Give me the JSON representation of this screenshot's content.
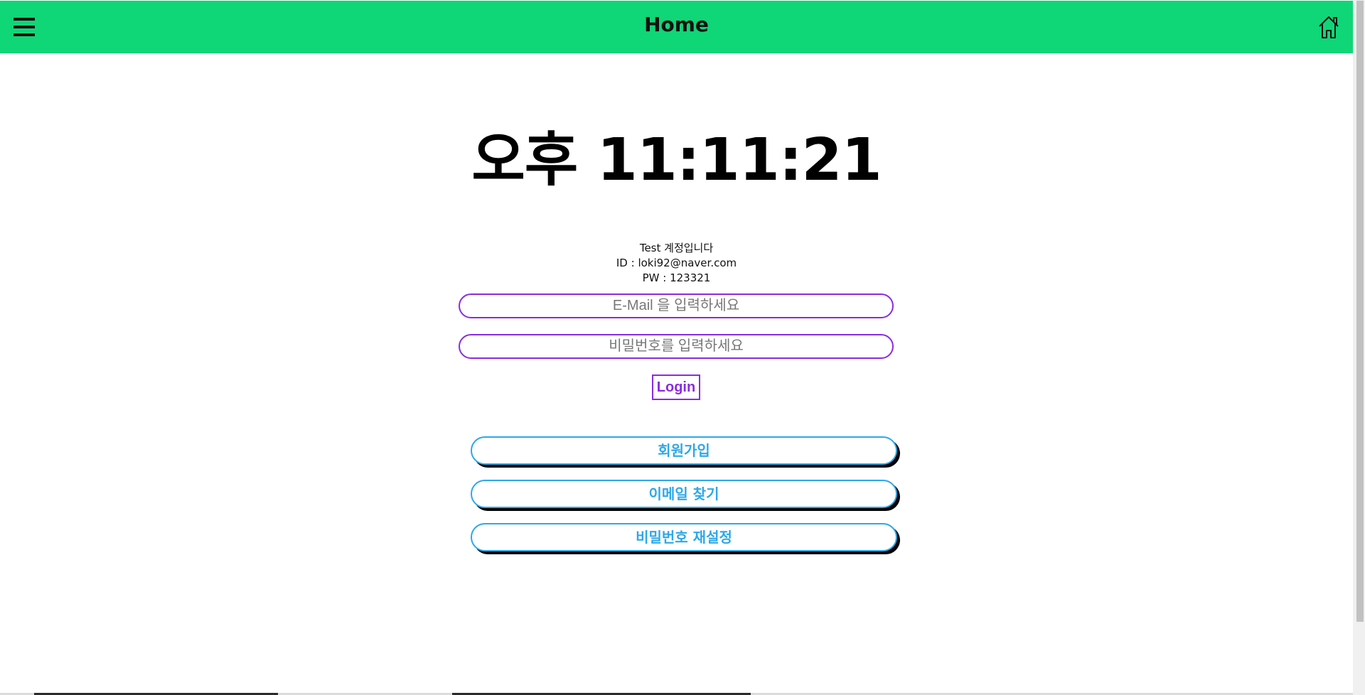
{
  "header": {
    "title": "Home",
    "menu_icon": "hamburger-menu-icon",
    "home_icon": "home-icon",
    "background_color": "#0fd677"
  },
  "clock": {
    "text": "오후 11:11:21"
  },
  "test_account": {
    "line1": "Test 계정입니다",
    "line2": "ID : loki92@naver.com",
    "line3": "PW : 123321"
  },
  "login_form": {
    "email_placeholder": "E-Mail 을 입력하세요",
    "email_value": "",
    "password_placeholder": "비밀번호를 입력하세요",
    "password_value": "",
    "login_label": "Login",
    "accent_color": "#8a2be2"
  },
  "account_links": {
    "signup_label": "회원가입",
    "find_email_label": "이메일 찾기",
    "reset_password_label": "비밀번호 재설정",
    "accent_color": "#2da8e8"
  }
}
